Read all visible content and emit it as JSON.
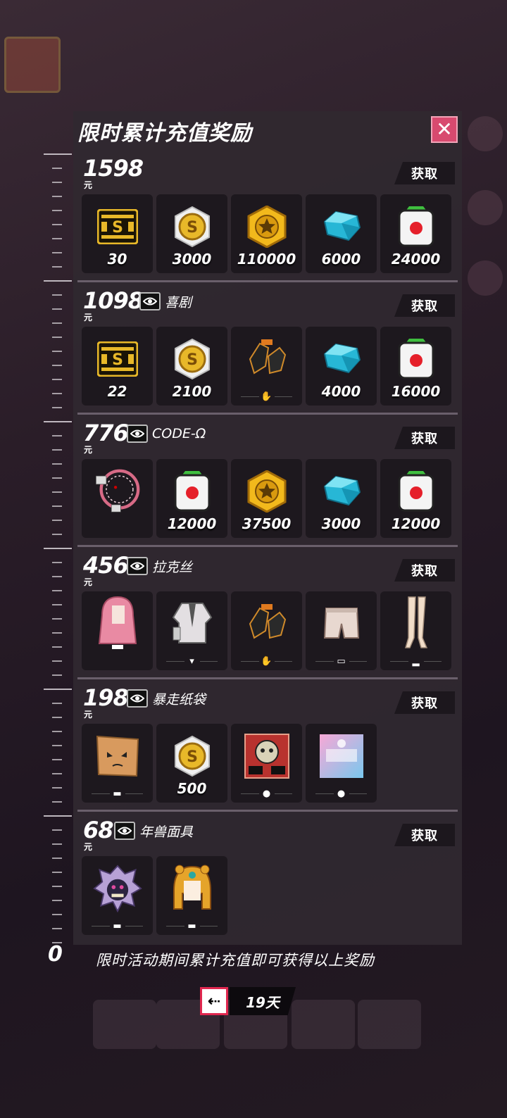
{
  "popup": {
    "title": "限时累计充值奖励",
    "close_label": "✕",
    "footer": "限时活动期间累计充值即可获得以上奖励",
    "timer_days": "19天",
    "ruler_zero": "0"
  },
  "common": {
    "get_label": "获取",
    "currency": "元"
  },
  "tiers": [
    {
      "amount": "1598",
      "skin": "",
      "items": [
        {
          "icon": "s-ticket-icon",
          "qty": "30"
        },
        {
          "icon": "gold-coin-icon",
          "qty": "3000"
        },
        {
          "icon": "star-medal-icon",
          "qty": "110000"
        },
        {
          "icon": "diamond-icon",
          "qty": "6000"
        },
        {
          "icon": "red-dot-box-icon",
          "qty": "24000"
        }
      ]
    },
    {
      "amount": "1098",
      "skin": "喜剧",
      "items": [
        {
          "icon": "s-ticket-icon",
          "qty": "22"
        },
        {
          "icon": "gold-coin-icon",
          "qty": "2100"
        },
        {
          "icon": "gloves-icon",
          "slot": "glove"
        },
        {
          "icon": "diamond-icon",
          "qty": "4000"
        },
        {
          "icon": "red-dot-box-icon",
          "qty": "16000"
        }
      ]
    },
    {
      "amount": "776",
      "skin": "CODE-Ω",
      "items": [
        {
          "icon": "ring-weapon-icon"
        },
        {
          "icon": "red-dot-box-icon",
          "qty": "12000"
        },
        {
          "icon": "star-medal-icon",
          "qty": "37500"
        },
        {
          "icon": "diamond-icon",
          "qty": "3000"
        },
        {
          "icon": "red-dot-box-icon",
          "qty": "12000"
        }
      ]
    },
    {
      "amount": "456",
      "skin": "拉克丝",
      "items": [
        {
          "icon": "pink-hair-icon"
        },
        {
          "icon": "jacket-icon",
          "slot": "shirt"
        },
        {
          "icon": "gloves-icon",
          "slot": "glove"
        },
        {
          "icon": "shorts-icon",
          "slot": "pants"
        },
        {
          "icon": "legs-icon",
          "slot": "shoe"
        }
      ]
    },
    {
      "amount": "198",
      "skin": "暴走纸袋",
      "items": [
        {
          "icon": "paper-bag-icon",
          "slot": "hat"
        },
        {
          "icon": "gold-coin-icon",
          "qty": "500"
        },
        {
          "icon": "mask-avatar-icon",
          "slot": "person"
        },
        {
          "icon": "pink-card-avatar-icon",
          "slot": "person"
        }
      ]
    },
    {
      "amount": "68",
      "skin": "年兽面具",
      "items": [
        {
          "icon": "lion-mask-icon",
          "slot": "hat"
        },
        {
          "icon": "tiger-hood-icon",
          "slot": "hat"
        }
      ]
    }
  ],
  "colors": {
    "close": "#d84a6f",
    "panel": "#302830",
    "card": "#1d181e",
    "gold": "#e8b829",
    "diamond": "#27b7d6",
    "timer_border": "#e0274f"
  }
}
